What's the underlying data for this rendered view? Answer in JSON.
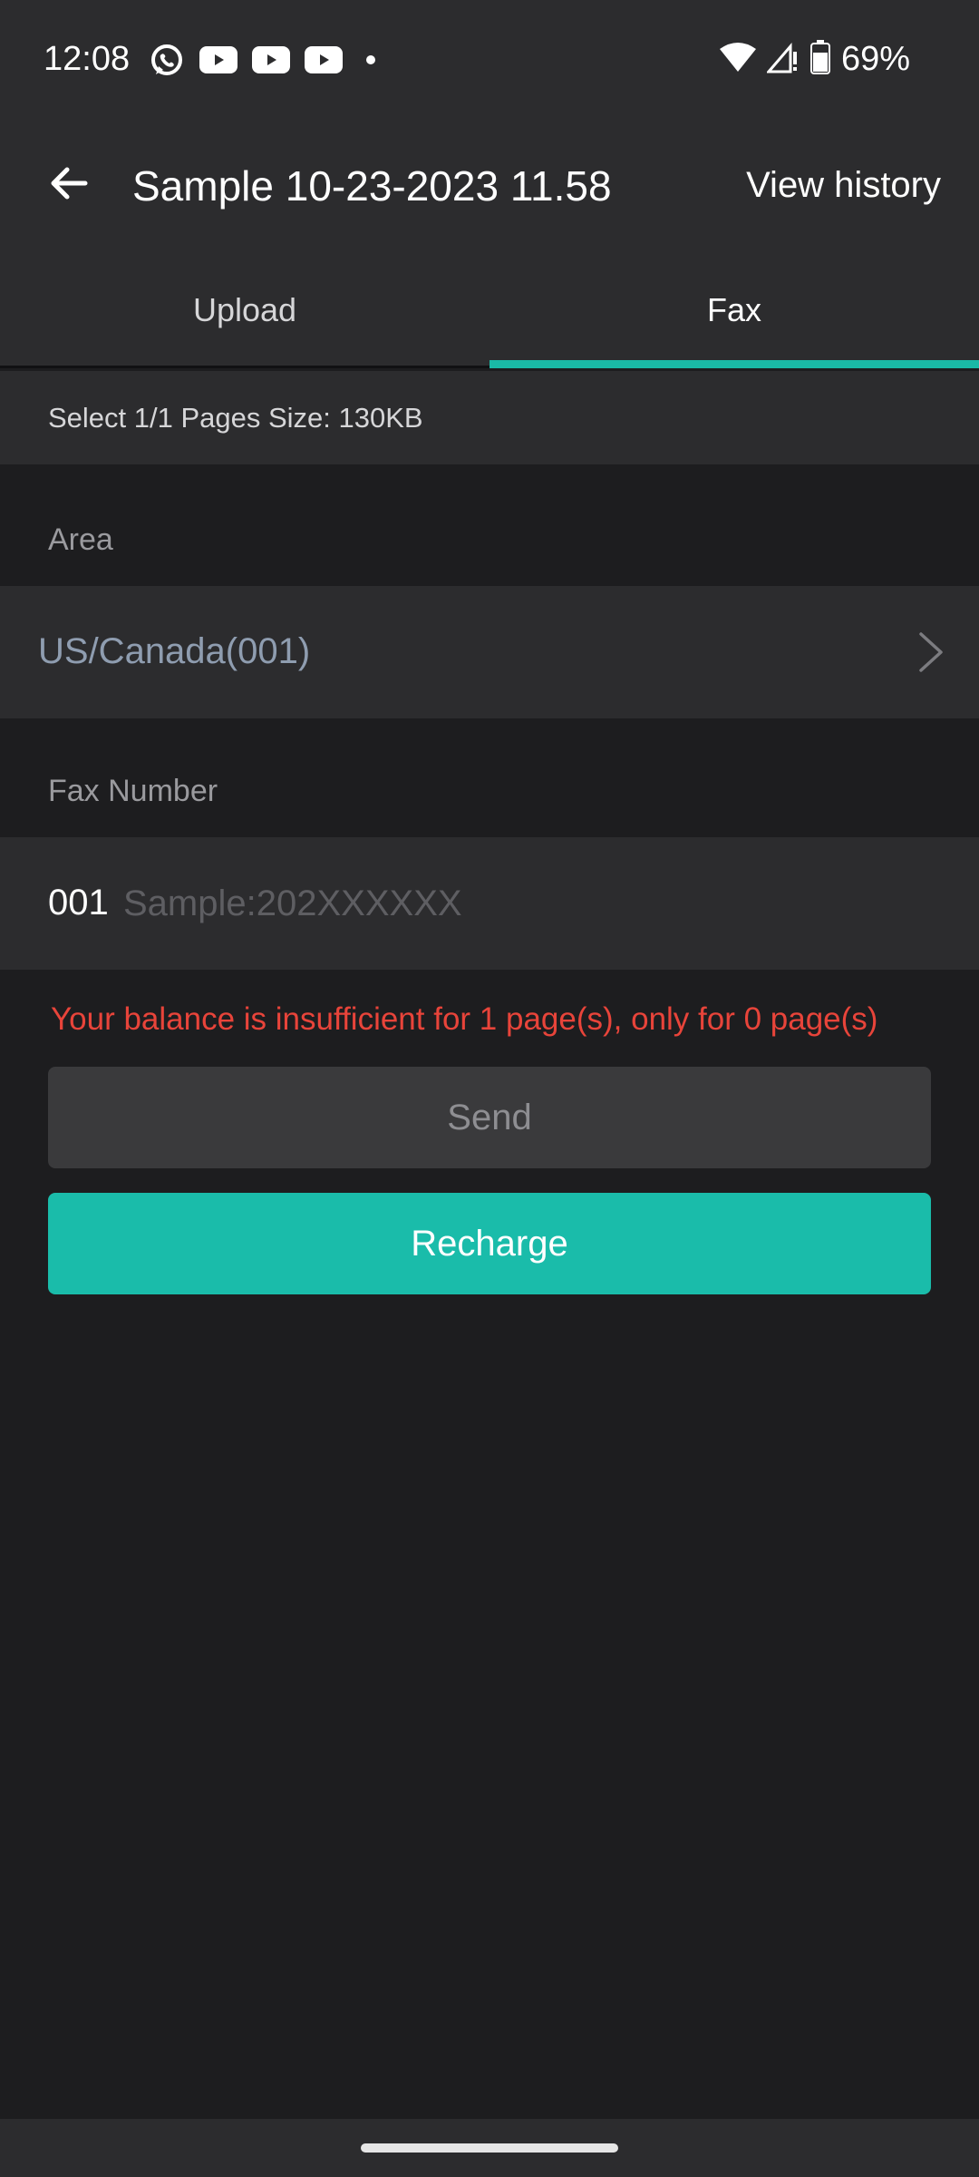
{
  "status_bar": {
    "time": "12:08",
    "left_icons": [
      "whatsapp-icon",
      "youtube-icon",
      "youtube-icon",
      "youtube-icon",
      "dot-icon"
    ],
    "right_icons": [
      "wifi-icon",
      "cell-signal-icon",
      "battery-icon"
    ],
    "battery": "69%"
  },
  "app_bar": {
    "back_icon": "arrow-left-icon",
    "title": "Sample 10-23-2023 11.58",
    "action": "View history"
  },
  "tabs": [
    {
      "label": "Upload",
      "active": false
    },
    {
      "label": "Fax",
      "active": true
    }
  ],
  "info": {
    "text": "Select 1/1 Pages  Size: 130KB"
  },
  "area": {
    "label": "Area",
    "value": "US/Canada(001)",
    "chevron_icon": "chevron-right-icon"
  },
  "fax_number": {
    "label": "Fax Number",
    "prefix": "001",
    "value": "",
    "placeholder": "Sample:202XXXXXX"
  },
  "error_message": "Your balance is insufficient for 1 page(s), only for 0 page(s)",
  "buttons": {
    "send": "Send",
    "recharge": "Recharge"
  },
  "colors": {
    "accent": "#1abcaa",
    "error": "#e8443a",
    "surface": "#2c2c2e",
    "background": "#1d1d1f"
  }
}
